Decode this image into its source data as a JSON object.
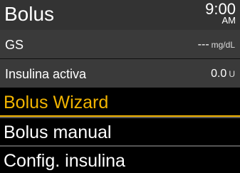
{
  "header": {
    "title": "Bolus",
    "time": "9:00",
    "ampm": "AM"
  },
  "info_rows": [
    {
      "label": "GS",
      "value": "---",
      "unit": "mg/dL"
    },
    {
      "label": "Insulina activa",
      "value": "0.0",
      "unit": "U"
    }
  ],
  "menu": {
    "items": [
      {
        "label": "Bolus Wizard"
      },
      {
        "label": "Bolus manual"
      },
      {
        "label": "Config. insulina"
      }
    ],
    "selected_index": 0
  },
  "colors": {
    "accent": "#f2b400",
    "header_bg": "#333333",
    "info_bg": "#3a3a3a",
    "background": "#000000"
  }
}
